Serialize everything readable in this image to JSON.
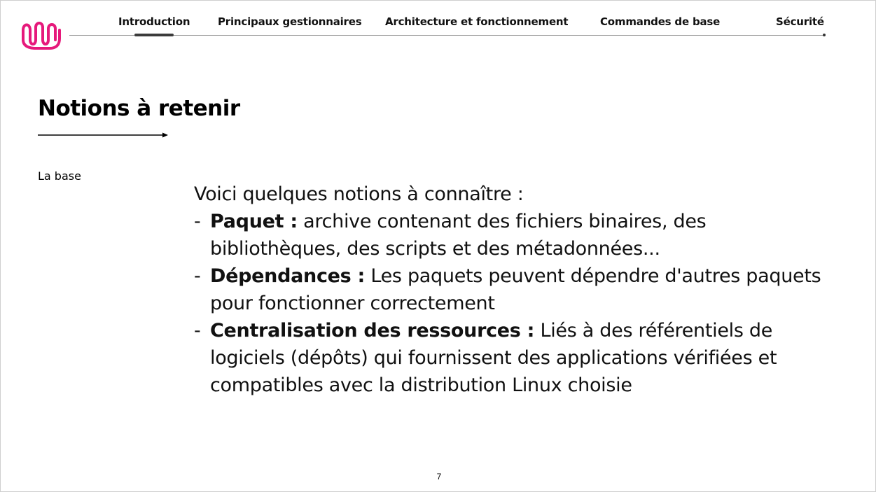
{
  "nav": {
    "items": [
      {
        "label": "Introduction",
        "active": true
      },
      {
        "label": "Principaux gestionnaires",
        "active": false
      },
      {
        "label": "Architecture et fonctionnement",
        "active": false
      },
      {
        "label": "Commandes de base",
        "active": false
      },
      {
        "label": "Sécurité",
        "active": false
      }
    ]
  },
  "brand": {
    "accent_color": "#e6197b",
    "logo_icon": "wave-logo-icon"
  },
  "slide": {
    "title": "Notions à retenir",
    "section_label": "La base",
    "intro": "Voici quelques notions à connaître :",
    "notions": [
      {
        "dash": "-",
        "term": "Paquet :",
        "text": " archive contenant des fichiers binaires, des bibliothèques, des scripts et des métadonnées..."
      },
      {
        "dash": "-",
        "term": "Dépendances :",
        "text": " Les paquets peuvent dépendre d'autres paquets pour fonctionner correctement"
      },
      {
        "dash": "-",
        "term": "Centralisation des ressources :",
        "text": " Liés à des référentiels de logiciels (dépôts) qui fournissent des applications vérifiées et compatibles avec la distribution Linux choisie"
      }
    ],
    "page_number": "7"
  }
}
